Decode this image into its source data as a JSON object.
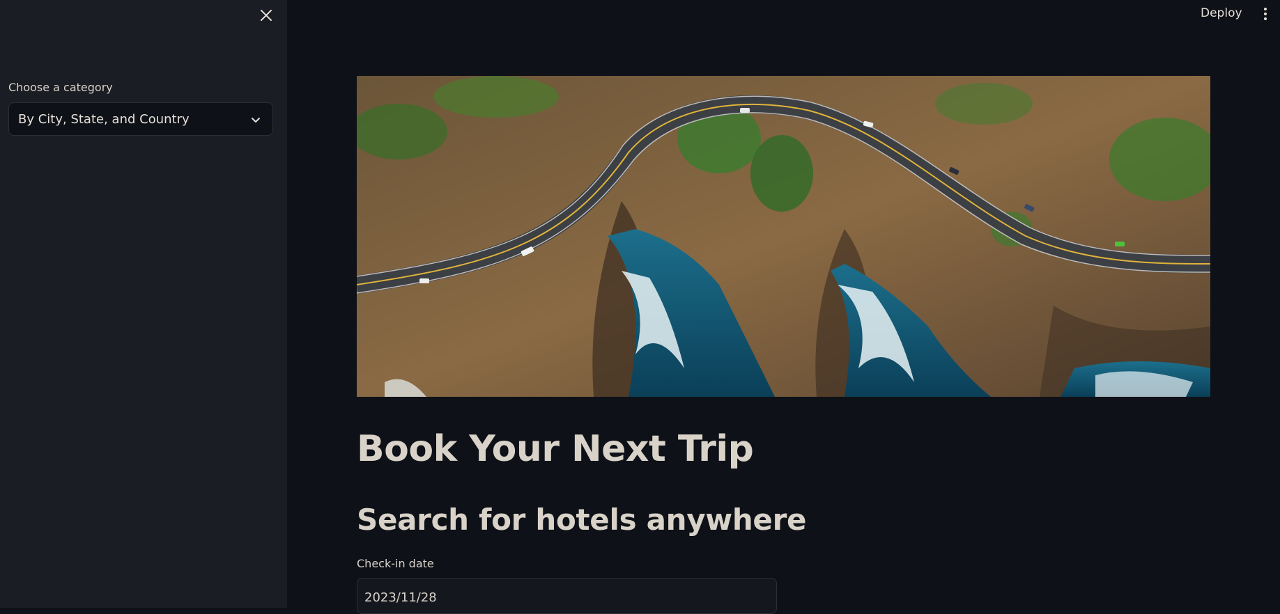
{
  "sidebar": {
    "category_label": "Choose a category",
    "category_selected": "By City, State, and Country"
  },
  "topbar": {
    "deploy_label": "Deploy"
  },
  "main": {
    "title": "Book Your Next Trip",
    "subtitle": "Search for hotels anywhere",
    "checkin": {
      "label": "Check-in date",
      "value": "2023/11/28"
    }
  },
  "colors": {
    "background": "#0e1117",
    "sidebar": "#1a1d23",
    "text": "#d8d2c9"
  }
}
